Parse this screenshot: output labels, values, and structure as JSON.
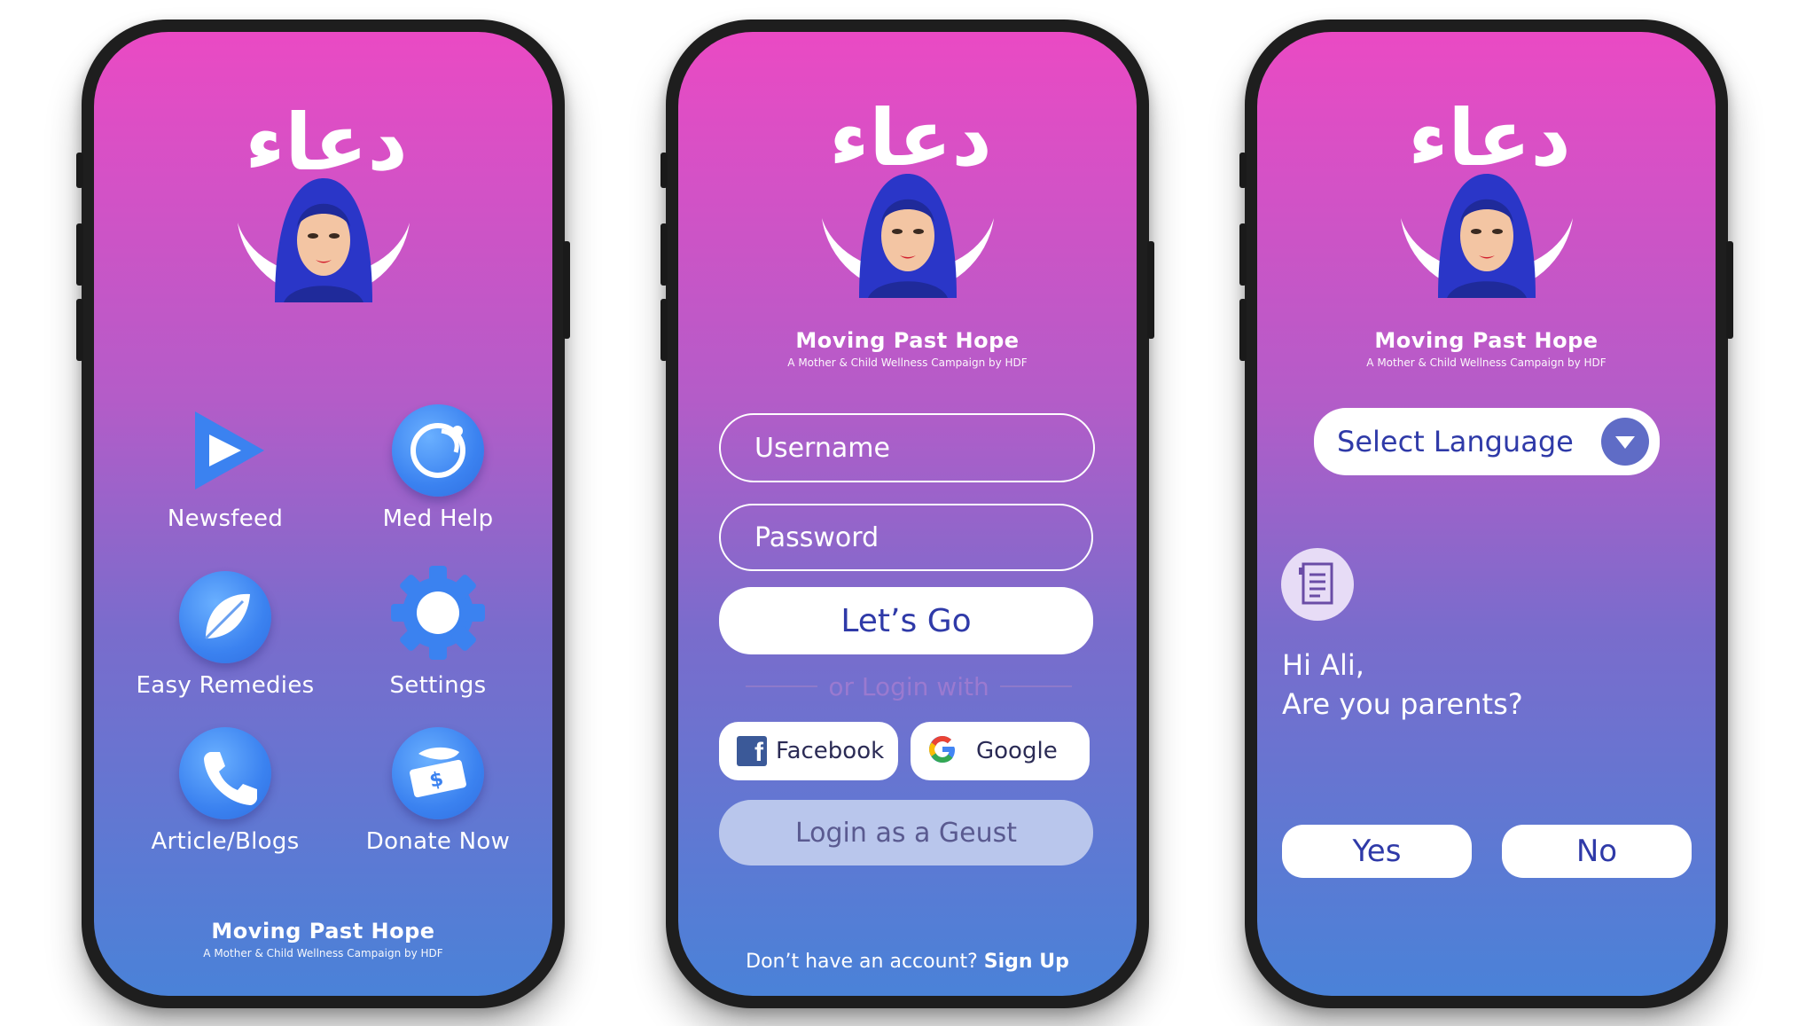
{
  "colors": {
    "gradient_top": "#ea4ac4",
    "gradient_bottom": "#4a82d8",
    "accent_blue": "#3b82f0",
    "button_text": "#2f3aa8"
  },
  "logo": {
    "arabic_text": "دعاء"
  },
  "brand": {
    "title": "Moving Past Hope",
    "subtitle": "A Mother & Child Wellness Campaign by HDF"
  },
  "home": {
    "menu": [
      {
        "label": "Newsfeed",
        "icon": "play-icon"
      },
      {
        "label": "Med Help",
        "icon": "stethoscope-icon"
      },
      {
        "label": "Easy Remedies",
        "icon": "leaf-icon"
      },
      {
        "label": "Settings",
        "icon": "gear-icon"
      },
      {
        "label": "Article/Blogs",
        "icon": "phone-icon"
      },
      {
        "label": "Donate Now",
        "icon": "money-icon"
      }
    ]
  },
  "login": {
    "username_placeholder": "Username",
    "password_placeholder": "Password",
    "submit_label": "Let’s Go",
    "divider_text": "or Login with",
    "facebook_label": "Facebook",
    "google_label": "Google",
    "guest_label": "Login as a Geust",
    "signup_prompt": "Don’t have an account?",
    "signup_link": "Sign Up"
  },
  "onboarding": {
    "language_placeholder": "Select Language",
    "greeting_line1": "Hi Ali,",
    "greeting_line2": "Are you parents?",
    "yes_label": "Yes",
    "no_label": "No"
  }
}
